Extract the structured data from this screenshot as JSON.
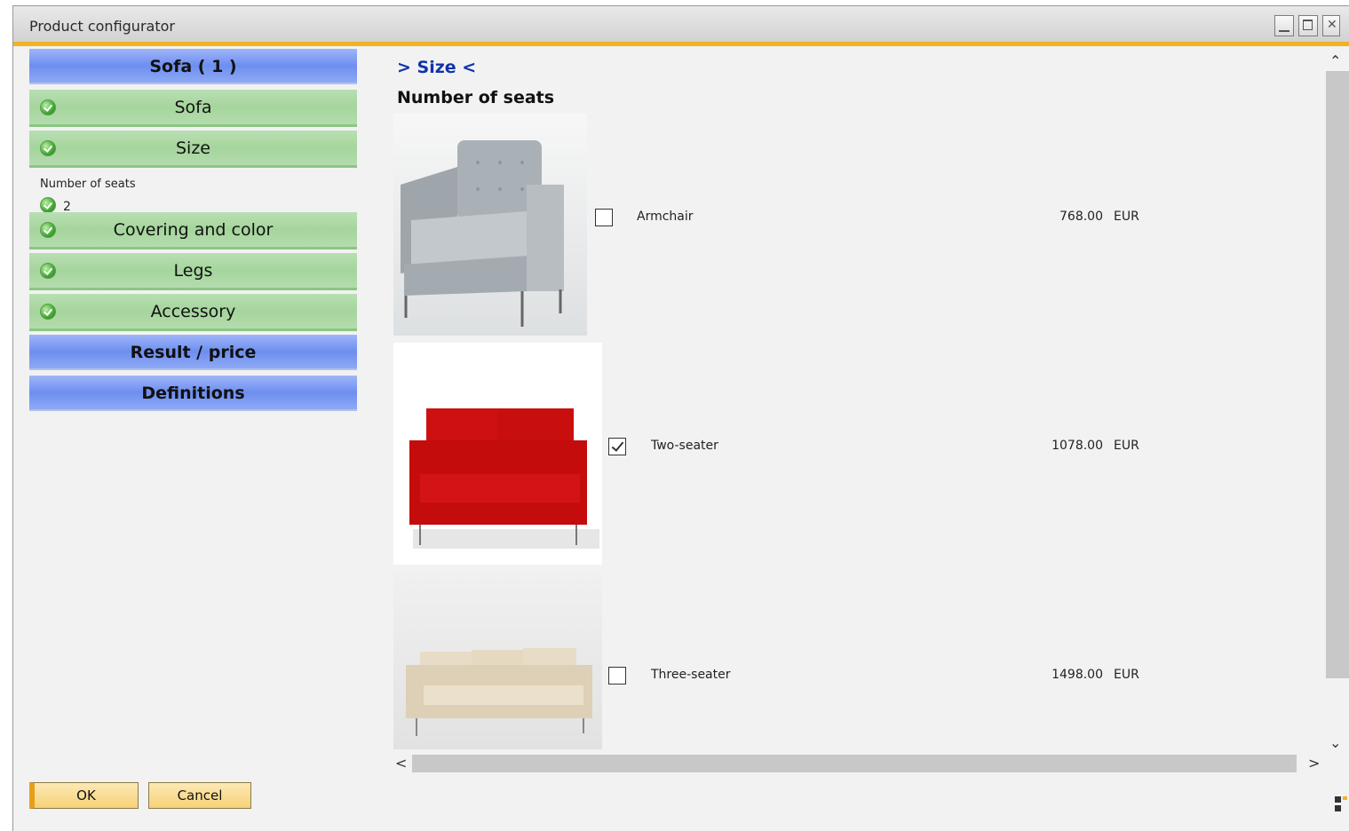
{
  "window": {
    "title": "Product configurator",
    "controls": {
      "minimize": "minimize-icon",
      "maximize": "maximize-icon",
      "close": "close-icon"
    }
  },
  "nav": {
    "header": "Sofa  ( 1 )",
    "steps": [
      {
        "label": "Sofa",
        "status": "complete"
      },
      {
        "label": "Size",
        "status": "complete"
      }
    ],
    "sub": {
      "label": "Number of seats",
      "value": "2"
    },
    "steps2": [
      {
        "label": "Covering and color",
        "status": "complete"
      },
      {
        "label": "Legs",
        "status": "complete"
      },
      {
        "label": "Accessory",
        "status": "complete"
      }
    ],
    "result": "Result / price",
    "definitions": "Definitions"
  },
  "main": {
    "link_heading": "> Size <",
    "heading": "Number of seats",
    "options": [
      {
        "label": "Armchair",
        "price": "768.00",
        "currency": "EUR",
        "checked": false
      },
      {
        "label": "Two-seater",
        "price": "1078.00",
        "currency": "EUR",
        "checked": true
      },
      {
        "label": "Three-seater",
        "price": "1498.00",
        "currency": "EUR",
        "checked": false
      }
    ]
  },
  "footer": {
    "ok": "OK",
    "cancel": "Cancel"
  },
  "colors": {
    "accent": "#f0b323",
    "nav_header": "#6d8ef0",
    "nav_step": "#a5d59c",
    "link": "#1133aa"
  }
}
